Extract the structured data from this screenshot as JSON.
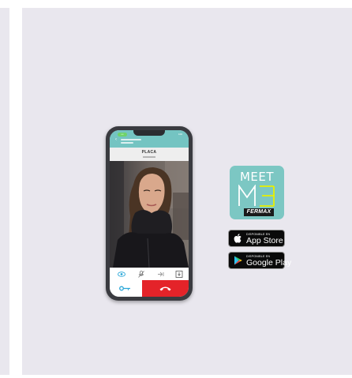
{
  "phone": {
    "status_label": "•••",
    "battery_label": "100",
    "screen_title": "PLACA"
  },
  "logo": {
    "word": "MEET",
    "brand": "FERMAX",
    "bg_color": "#7cc7c3"
  },
  "app_store": {
    "small_text": "DISPONIBLE EN",
    "big_text": "App Store",
    "icon": "apple-icon"
  },
  "google_play": {
    "small_text": "DISPONIBLE EN",
    "big_text": "Google Play",
    "icon": "google-play-icon"
  },
  "colors": {
    "panel": "#e9e7ee",
    "header": "#74c4c2",
    "hangup": "#e42329",
    "key": "#2aa7d8"
  }
}
